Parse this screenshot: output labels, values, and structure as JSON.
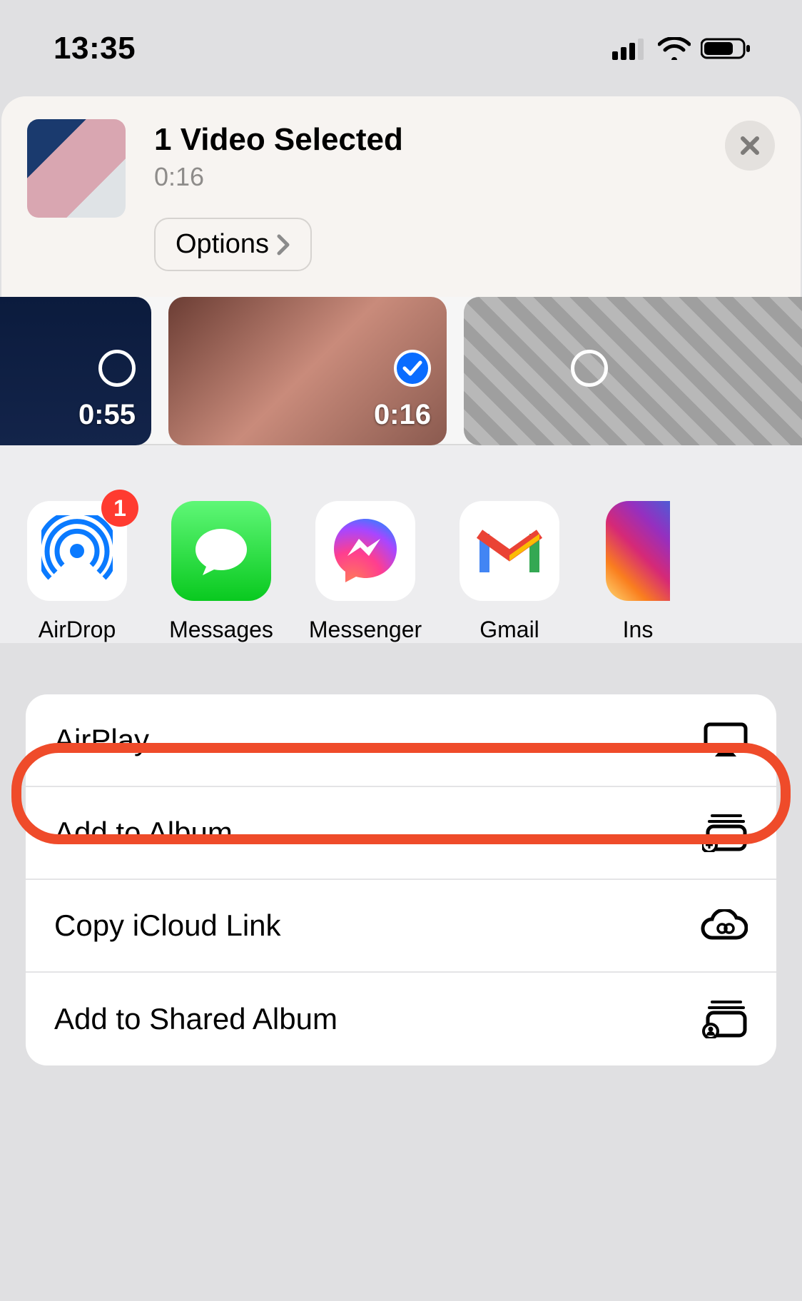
{
  "status": {
    "time": "13:35"
  },
  "header": {
    "title": "1 Video Selected",
    "duration": "0:16",
    "options_label": "Options"
  },
  "thumbs": [
    {
      "duration": "0:55",
      "selected": false
    },
    {
      "duration": "0:16",
      "selected": true
    },
    {
      "duration": "",
      "selected": false
    }
  ],
  "apps": {
    "airdrop": {
      "label": "AirDrop",
      "badge": "1"
    },
    "messages": {
      "label": "Messages"
    },
    "messenger": {
      "label": "Messenger"
    },
    "gmail": {
      "label": "Gmail"
    },
    "instagram": {
      "label": "Ins"
    }
  },
  "actions": {
    "airplay": "AirPlay",
    "add_album": "Add to Album",
    "copy_link": "Copy iCloud Link",
    "shared_album": "Add to Shared Album"
  }
}
